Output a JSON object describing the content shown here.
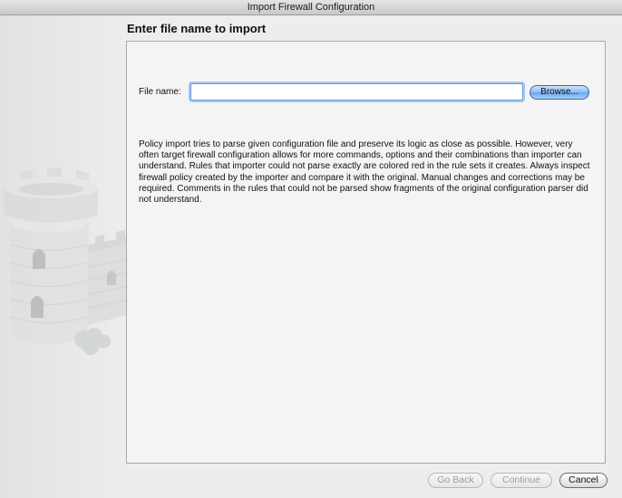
{
  "window": {
    "title": "Import Firewall Configuration"
  },
  "page": {
    "heading": "Enter file name to import"
  },
  "file": {
    "label": "File name:",
    "value": "",
    "browse_label": "Browse..."
  },
  "description": "Policy import tries to parse given configuration file and preserve its logic as close as possible. However, very often target firewall configuration allows for more commands, options and their combinations than importer can understand. Rules that importer could not parse exactly are colored red in the rule sets it creates. Always inspect firewall policy created by the importer and compare it with the original. Manual changes and corrections may be required. Comments in the rules that could not be parsed show fragments of the original configuration parser did not understand.",
  "buttons": {
    "back_label": "Go Back",
    "continue_label": "Continue",
    "cancel_label": "Cancel"
  },
  "icons": {
    "watermark": "castle-tower-icon"
  },
  "colors": {
    "accent": "#6aa6ea",
    "focus_ring": "#a9c8ee",
    "disabled_text": "#9c9c9c"
  }
}
